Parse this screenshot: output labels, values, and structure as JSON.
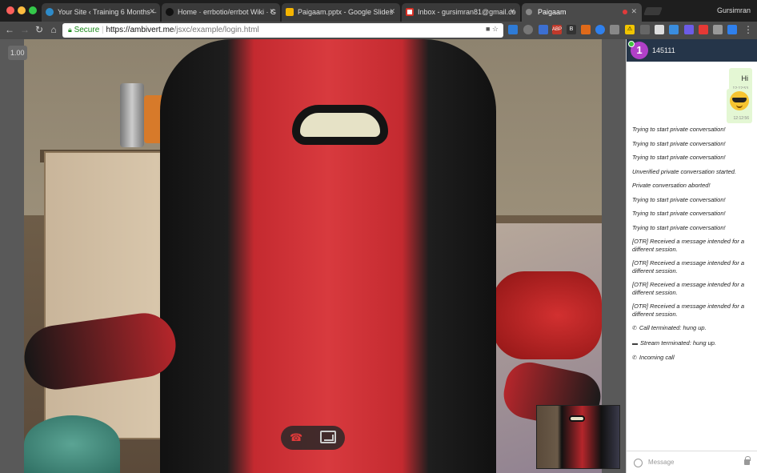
{
  "browser": {
    "tabs": [
      {
        "label": "Your Site ‹ Training 6 Months –",
        "favicon_color": "#2e8bc9",
        "active": false
      },
      {
        "label": "Home · errbotio/errbot Wiki · G",
        "favicon_color": "#111111",
        "active": false
      },
      {
        "label": "Paigaam.pptx - Google Slides",
        "favicon_color": "#f4b400",
        "active": false
      },
      {
        "label": "Inbox - gursimran81@gmail.co",
        "favicon_color": "#d93025",
        "active": false
      },
      {
        "label": "Paigaam",
        "favicon_color": "#888888",
        "active": true
      }
    ],
    "user": "Gursimran",
    "toolbar": {
      "back_icon": "back-arrow-icon",
      "forward_icon": "forward-arrow-icon",
      "reload_icon": "reload-icon",
      "home_icon": "home-icon",
      "secure_label": "Secure",
      "url_host": "https://ambivert.me",
      "url_path": "/jsxc/example/login.html"
    },
    "extensions": [
      "ABP",
      "B",
      "⚠"
    ]
  },
  "video": {
    "zoom_label": "1.00",
    "hangup_icon": "phone-hangup-icon",
    "fullscreen_icon": "fullscreen-icon",
    "pip_label": "Self view"
  },
  "chat": {
    "avatar_letter": "1",
    "contact": "145111",
    "outgoing": [
      {
        "text": "Hi",
        "time": "12:12:53"
      },
      {
        "text": "",
        "emoji": "sunglasses-emoji",
        "time": "12:12:56"
      }
    ],
    "system_messages": [
      {
        "text": "Trying to start private conversation!",
        "icon": ""
      },
      {
        "text": "Trying to start private conversation!",
        "icon": ""
      },
      {
        "text": "Trying to start private conversation!",
        "icon": ""
      },
      {
        "text": "Unverified private conversation started.",
        "icon": ""
      },
      {
        "text": "Private conversation aborted!",
        "icon": ""
      },
      {
        "text": "Trying to start private conversation!",
        "icon": ""
      },
      {
        "text": "Trying to start private conversation!",
        "icon": ""
      },
      {
        "text": "Trying to start private conversation!",
        "icon": ""
      },
      {
        "text": "[OTR] Received a message intended for a different session.",
        "icon": ""
      },
      {
        "text": "[OTR] Received a message intended for a different session.",
        "icon": ""
      },
      {
        "text": "[OTR] Received a message intended for a different session.",
        "icon": ""
      },
      {
        "text": "[OTR] Received a message intended for a different session.",
        "icon": ""
      },
      {
        "text": "Call terminated: hung up.",
        "icon": "phone-icon"
      },
      {
        "text": "Stream terminated: hung up.",
        "icon": "screen-icon"
      },
      {
        "text": "Incoming call",
        "icon": "phone-icon"
      }
    ],
    "input_placeholder": "Message"
  }
}
